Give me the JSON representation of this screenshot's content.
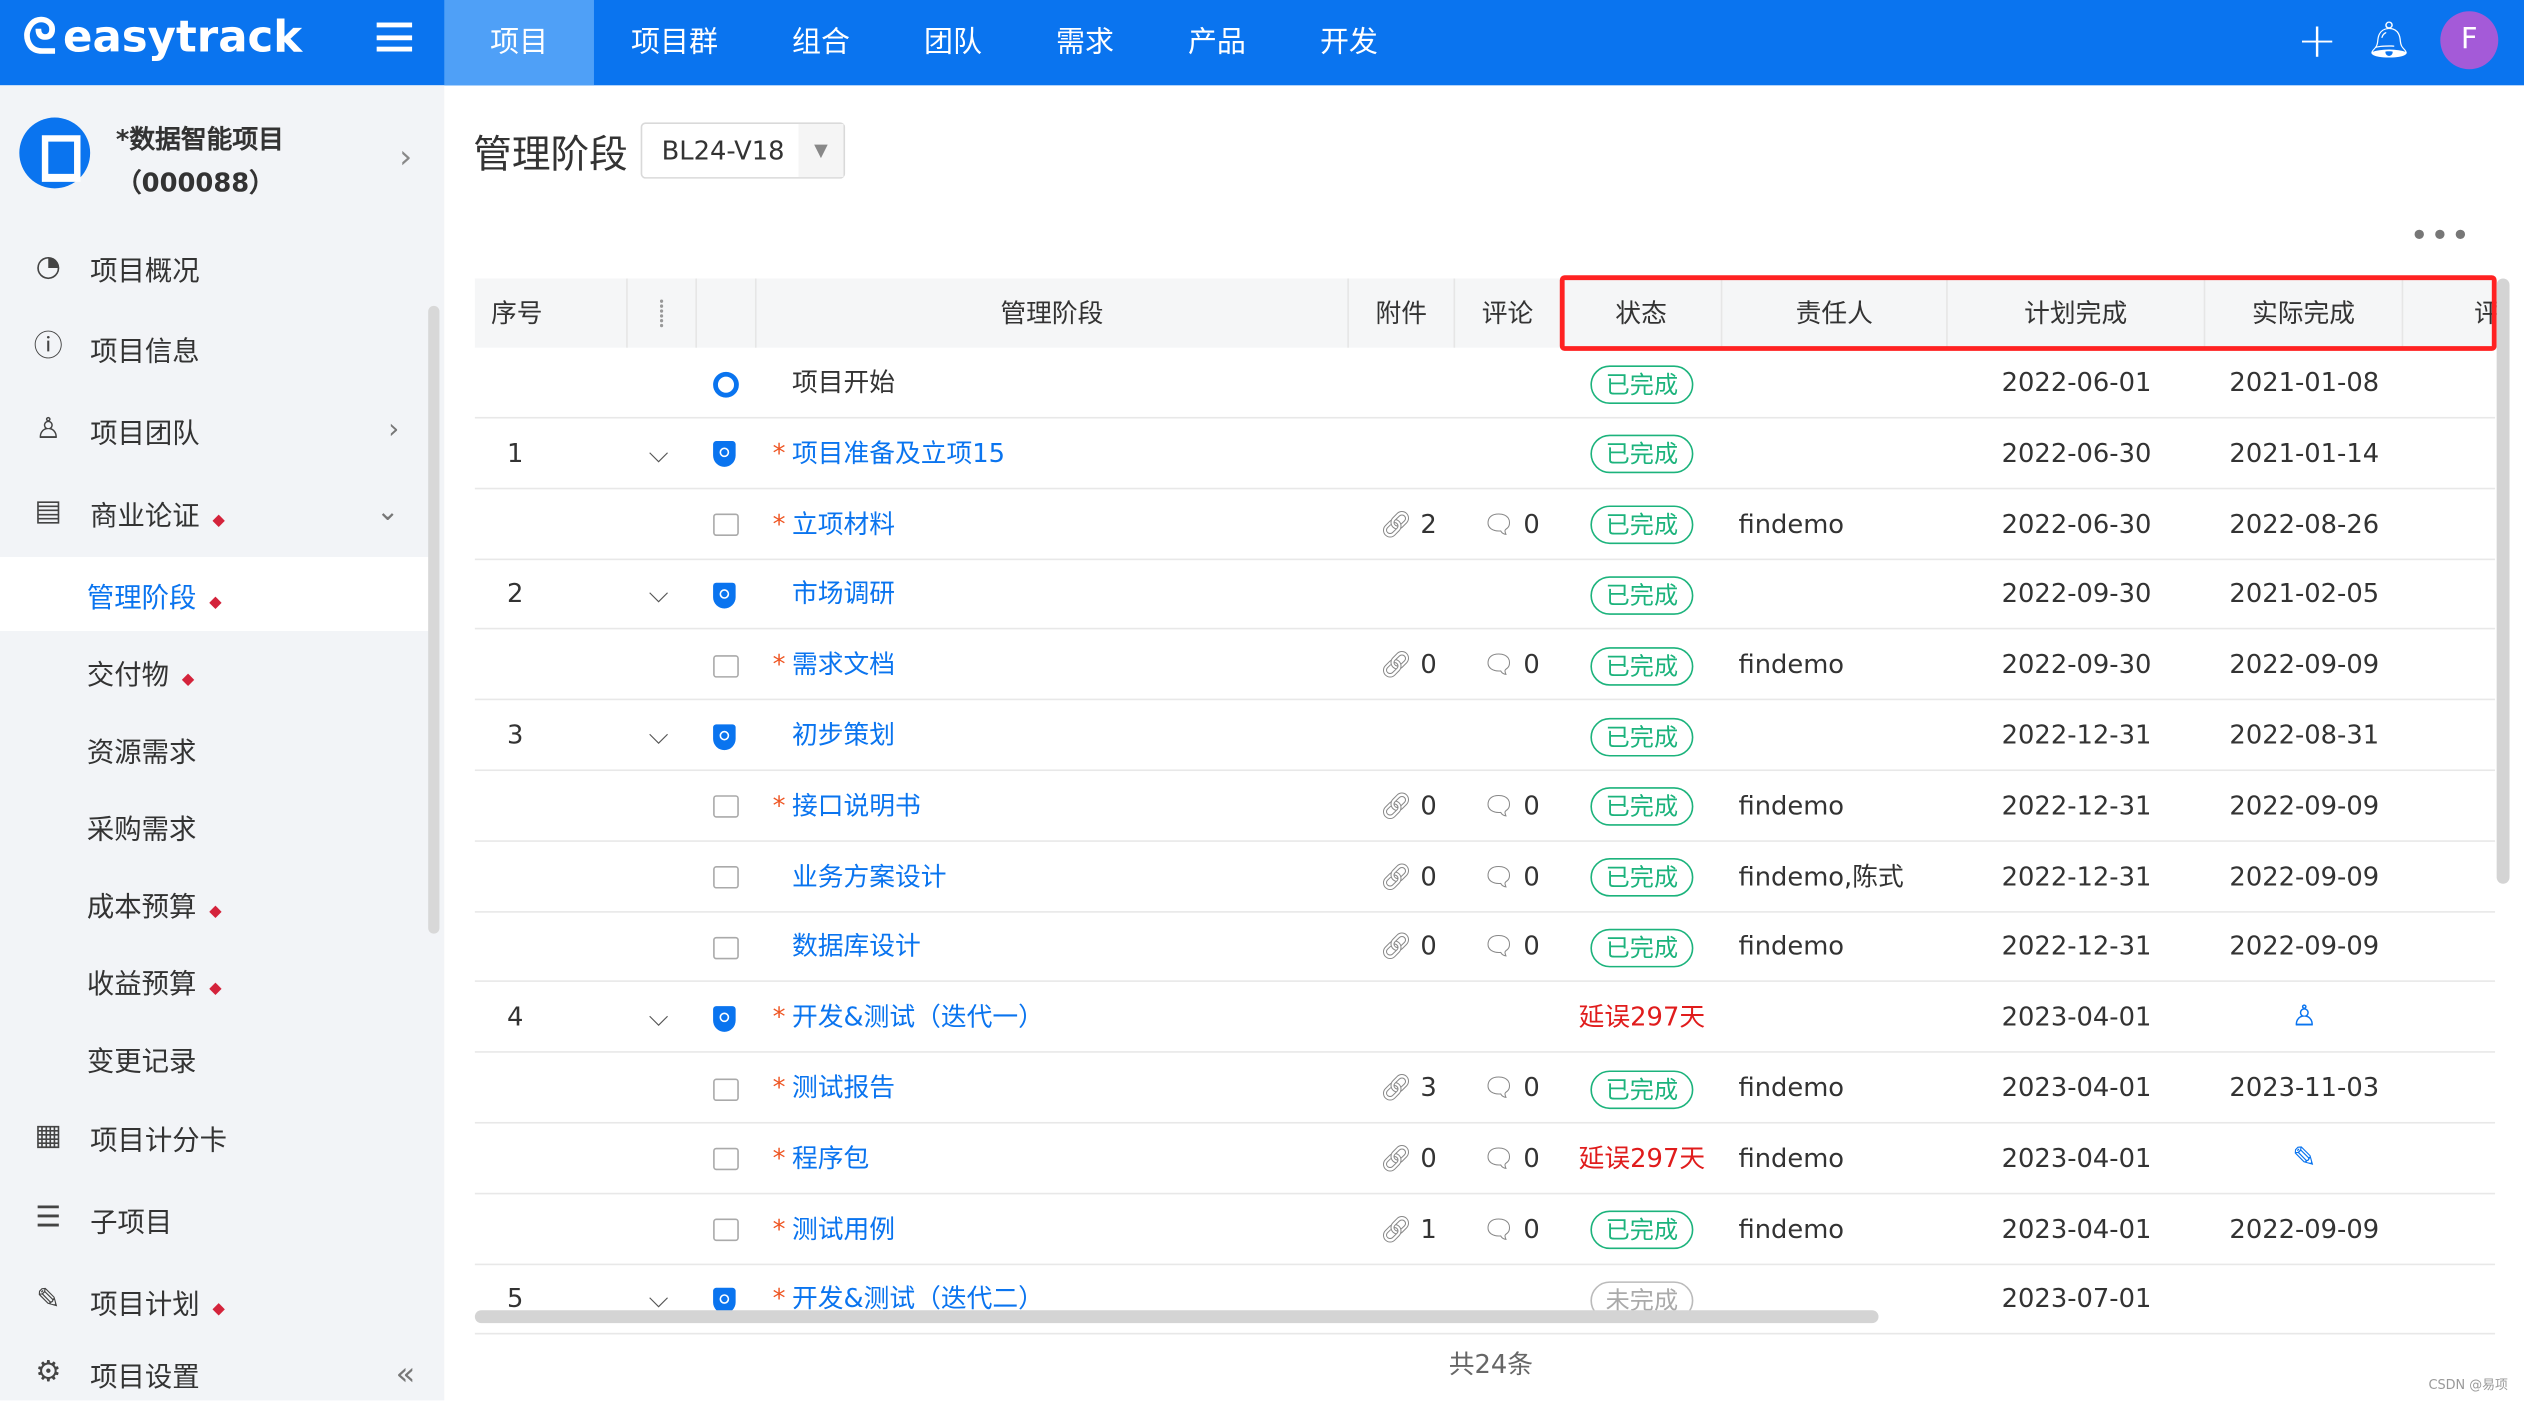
{
  "topbar": {
    "logo": "easytrack",
    "nav": [
      "项目",
      "项目群",
      "组合",
      "团队",
      "需求",
      "产品",
      "开发"
    ],
    "active_nav": 0,
    "avatar": "F",
    "brand_color": "#0a74ef"
  },
  "sidebar": {
    "project_name": "*数据智能项目（000088）",
    "items": [
      {
        "label": "项目概况",
        "icon": "pie-chart-icon"
      },
      {
        "label": "项目信息",
        "icon": "info-icon"
      },
      {
        "label": "项目团队",
        "icon": "team-icon",
        "chevron": "right"
      },
      {
        "label": "商业论证",
        "icon": "presentation-icon",
        "chevron": "down",
        "dot": true
      },
      {
        "label": "管理阶段",
        "sub": true,
        "dot": true,
        "active": true
      },
      {
        "label": "交付物",
        "sub": true,
        "dot": true
      },
      {
        "label": "资源需求",
        "sub": true
      },
      {
        "label": "采购需求",
        "sub": true
      },
      {
        "label": "成本预算",
        "sub": true,
        "dot": true
      },
      {
        "label": "收益预算",
        "sub": true,
        "dot": true
      },
      {
        "label": "变更记录",
        "sub": true
      },
      {
        "label": "项目计分卡",
        "icon": "calendar-icon"
      },
      {
        "label": "子项目",
        "icon": "list-icon"
      },
      {
        "label": "项目计划",
        "icon": "edit-list-icon",
        "dot": true
      },
      {
        "label": "项目设置",
        "icon": "gear-icon"
      }
    ]
  },
  "main": {
    "title": "管理阶段",
    "version": "BL24-V18",
    "more": "•••",
    "columns": [
      "序号",
      "",
      "",
      "管理阶段",
      "附件",
      "评论",
      "状态",
      "责任人",
      "计划完成",
      "实际完成",
      "评"
    ],
    "rows": [
      {
        "no": "",
        "tree": false,
        "type": "start",
        "name": "项目开始",
        "req": false,
        "att": "",
        "com": "",
        "status": "已完成",
        "owner": "",
        "plan": "2022-06-01",
        "actual": "2021-01-08"
      },
      {
        "no": "1",
        "tree": true,
        "type": "stage",
        "name": "项目准备及立项15",
        "req": true,
        "att": "",
        "com": "",
        "status": "已完成",
        "owner": "",
        "plan": "2022-06-30",
        "actual": "2021-01-14"
      },
      {
        "no": "",
        "tree": false,
        "type": "doc",
        "name": "立项材料",
        "req": true,
        "att": "2",
        "com": "0",
        "status": "已完成",
        "owner": "findemo",
        "plan": "2022-06-30",
        "actual": "2022-08-26"
      },
      {
        "no": "2",
        "tree": true,
        "type": "stage",
        "name": "市场调研",
        "req": false,
        "att": "",
        "com": "",
        "status": "已完成",
        "owner": "",
        "plan": "2022-09-30",
        "actual": "2021-02-05"
      },
      {
        "no": "",
        "tree": false,
        "type": "doc",
        "name": "需求文档",
        "req": true,
        "att": "0",
        "com": "0",
        "status": "已完成",
        "owner": "findemo",
        "plan": "2022-09-30",
        "actual": "2022-09-09"
      },
      {
        "no": "3",
        "tree": true,
        "type": "stage",
        "name": "初步策划",
        "req": false,
        "att": "",
        "com": "",
        "status": "已完成",
        "owner": "",
        "plan": "2022-12-31",
        "actual": "2022-08-31"
      },
      {
        "no": "",
        "tree": false,
        "type": "doc",
        "name": "接口说明书",
        "req": true,
        "att": "0",
        "com": "0",
        "status": "已完成",
        "owner": "findemo",
        "plan": "2022-12-31",
        "actual": "2022-09-09"
      },
      {
        "no": "",
        "tree": false,
        "type": "doc",
        "name": "业务方案设计",
        "req": false,
        "att": "0",
        "com": "0",
        "status": "已完成",
        "owner": "findemo,陈式",
        "plan": "2022-12-31",
        "actual": "2022-09-09"
      },
      {
        "no": "",
        "tree": false,
        "type": "doc",
        "name": "数据库设计",
        "req": false,
        "att": "0",
        "com": "0",
        "status": "已完成",
        "owner": "findemo",
        "plan": "2022-12-31",
        "actual": "2022-09-09"
      },
      {
        "no": "4",
        "tree": true,
        "type": "stage",
        "name": "开发&测试（迭代一）",
        "req": true,
        "att": "",
        "com": "",
        "status": "延误297天",
        "owner": "",
        "plan": "2023-04-01",
        "actual": "",
        "actual_icon": "user-icon"
      },
      {
        "no": "",
        "tree": false,
        "type": "doc",
        "name": "测试报告",
        "req": true,
        "att": "3",
        "com": "0",
        "status": "已完成",
        "owner": "findemo",
        "plan": "2023-04-01",
        "actual": "2023-11-03"
      },
      {
        "no": "",
        "tree": false,
        "type": "doc",
        "name": "程序包",
        "req": true,
        "att": "0",
        "com": "0",
        "status": "延误297天",
        "owner": "findemo",
        "plan": "2023-04-01",
        "actual": "",
        "actual_icon": "pencil-icon"
      },
      {
        "no": "",
        "tree": false,
        "type": "doc",
        "name": "测试用例",
        "req": true,
        "att": "1",
        "com": "0",
        "status": "已完成",
        "owner": "findemo",
        "plan": "2023-04-01",
        "actual": "2022-09-09"
      },
      {
        "no": "5",
        "tree": true,
        "type": "stage",
        "name": "开发&测试（迭代二）",
        "req": true,
        "att": "",
        "com": "",
        "status": "未完成",
        "owner": "",
        "plan": "2023-07-01",
        "actual": ""
      }
    ],
    "total": "共24条"
  },
  "watermark": "CSDN @易项"
}
